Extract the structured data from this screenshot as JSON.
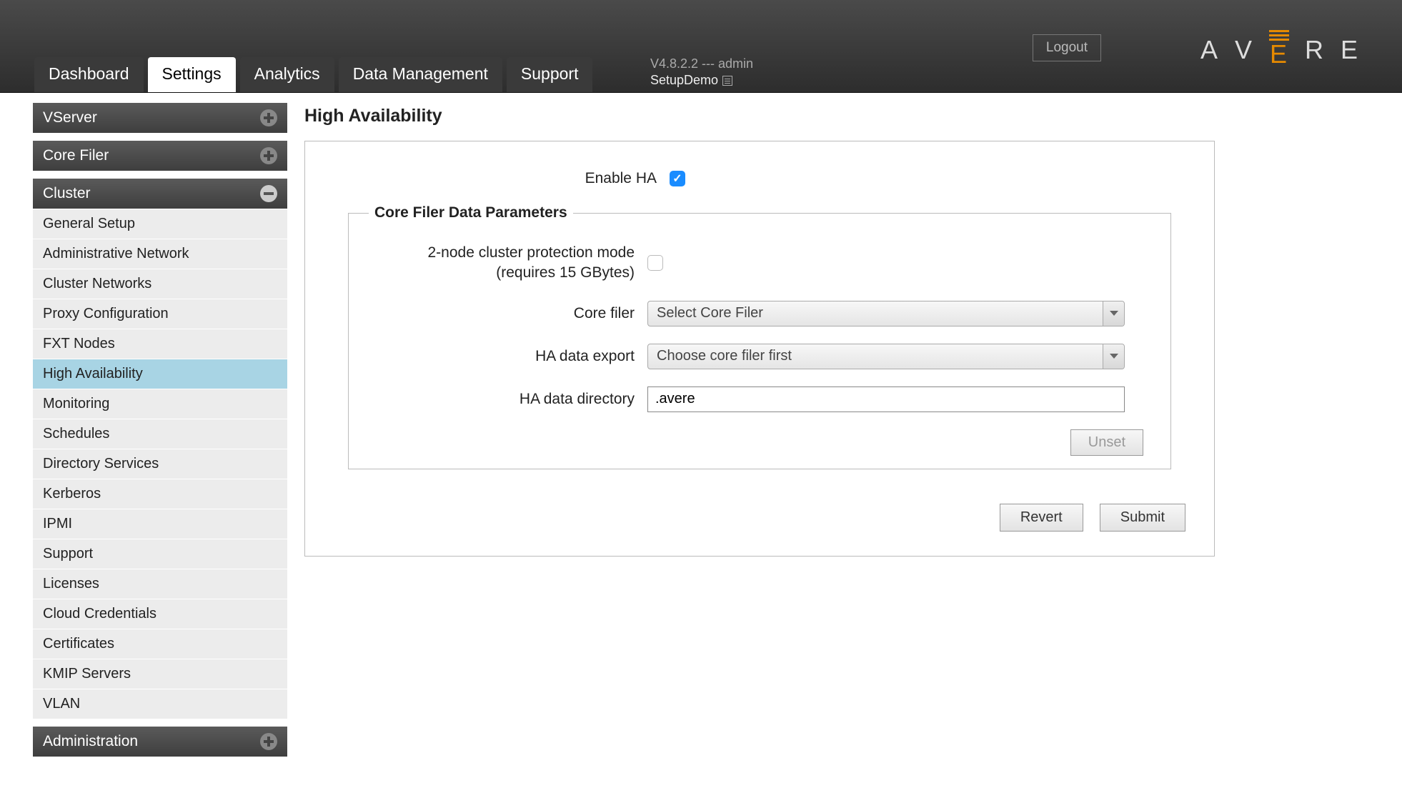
{
  "header": {
    "logout": "Logout",
    "version_line": "V4.8.2.2 --- admin",
    "cluster_name": "SetupDemo",
    "logo_letters": [
      "A",
      "V",
      "E",
      "R",
      "E"
    ]
  },
  "tabs": [
    {
      "label": "Dashboard",
      "active": false
    },
    {
      "label": "Settings",
      "active": true
    },
    {
      "label": "Analytics",
      "active": false
    },
    {
      "label": "Data Management",
      "active": false
    },
    {
      "label": "Support",
      "active": false
    }
  ],
  "sidebar": {
    "sections": [
      {
        "title": "VServer",
        "expanded": false,
        "items": []
      },
      {
        "title": "Core Filer",
        "expanded": false,
        "items": []
      },
      {
        "title": "Cluster",
        "expanded": true,
        "items": [
          {
            "label": "General Setup",
            "active": false
          },
          {
            "label": "Administrative Network",
            "active": false
          },
          {
            "label": "Cluster Networks",
            "active": false
          },
          {
            "label": "Proxy Configuration",
            "active": false
          },
          {
            "label": "FXT Nodes",
            "active": false
          },
          {
            "label": "High Availability",
            "active": true
          },
          {
            "label": "Monitoring",
            "active": false
          },
          {
            "label": "Schedules",
            "active": false
          },
          {
            "label": "Directory Services",
            "active": false
          },
          {
            "label": "Kerberos",
            "active": false
          },
          {
            "label": "IPMI",
            "active": false
          },
          {
            "label": "Support",
            "active": false
          },
          {
            "label": "Licenses",
            "active": false
          },
          {
            "label": "Cloud Credentials",
            "active": false
          },
          {
            "label": "Certificates",
            "active": false
          },
          {
            "label": "KMIP Servers",
            "active": false
          },
          {
            "label": "VLAN",
            "active": false
          }
        ]
      },
      {
        "title": "Administration",
        "expanded": false,
        "items": []
      }
    ]
  },
  "main": {
    "title": "High Availability",
    "enable_ha_label": "Enable HA",
    "enable_ha_checked": true,
    "fieldset_title": "Core Filer Data Parameters",
    "two_node_label": "2-node cluster protection mode (requires 15 GBytes)",
    "two_node_checked": false,
    "core_filer_label": "Core filer",
    "core_filer_value": "Select Core Filer",
    "ha_export_label": "HA data export",
    "ha_export_value": "Choose core filer first",
    "ha_dir_label": "HA data directory",
    "ha_dir_value": ".avere",
    "unset_btn": "Unset",
    "revert_btn": "Revert",
    "submit_btn": "Submit"
  }
}
